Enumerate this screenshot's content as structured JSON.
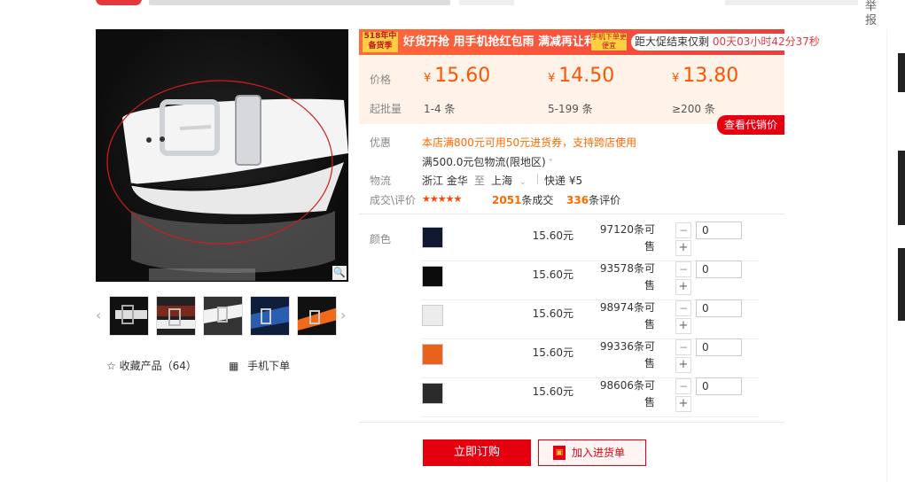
{
  "header": {
    "report_label": "举报"
  },
  "gallery": {
    "zoom_icon": "magnifier-icon",
    "collect_label": "收藏产品（64）",
    "mobile_order_label": "手机下单"
  },
  "promo": {
    "badge": "518年中备货季",
    "text": "好货开抢 用手机抢红包雨 满减再让利!",
    "tag": "手机下单更便宜",
    "countdown_prefix": "距大促结束仅剩",
    "countdown_time": "00天03小时42分37秒"
  },
  "pricing": {
    "price_label": "价格",
    "moq_label": "起批量",
    "tiers": [
      {
        "price": "15.60",
        "qty": "1-4 条"
      },
      {
        "price": "14.50",
        "qty": "5-199 条"
      },
      {
        "price": "13.80",
        "qty": "≥200 条"
      }
    ],
    "currency": "¥",
    "agent_price_button": "查看代销价"
  },
  "details": {
    "discount_label": "优惠",
    "discount_text": "本店满800元可用50元进货券，支持跨店使用",
    "shipping_free": "满500.0元包物流(限地区)",
    "logistics_label": "物流",
    "origin": "浙江 金华",
    "to_word": "至",
    "destination": "上海",
    "express": "快递 ¥5",
    "deals_label": "成交\\评价",
    "stars": "★★★★★",
    "deal_count": "2051",
    "deal_unit": "条成交",
    "review_count": "336",
    "review_unit": "条评价"
  },
  "sku": {
    "color_label": "颜色",
    "rows": [
      {
        "price": "15.60元",
        "stock": "97120条可售",
        "qty": "0"
      },
      {
        "price": "15.60元",
        "stock": "93578条可售",
        "qty": "0"
      },
      {
        "price": "15.60元",
        "stock": "98974条可售",
        "qty": "0"
      },
      {
        "price": "15.60元",
        "stock": "99336条可售",
        "qty": "0"
      },
      {
        "price": "15.60元",
        "stock": "98606条可售",
        "qty": "0"
      }
    ]
  },
  "actions": {
    "order_button": "立即订购",
    "cart_button": "加入进货单"
  }
}
